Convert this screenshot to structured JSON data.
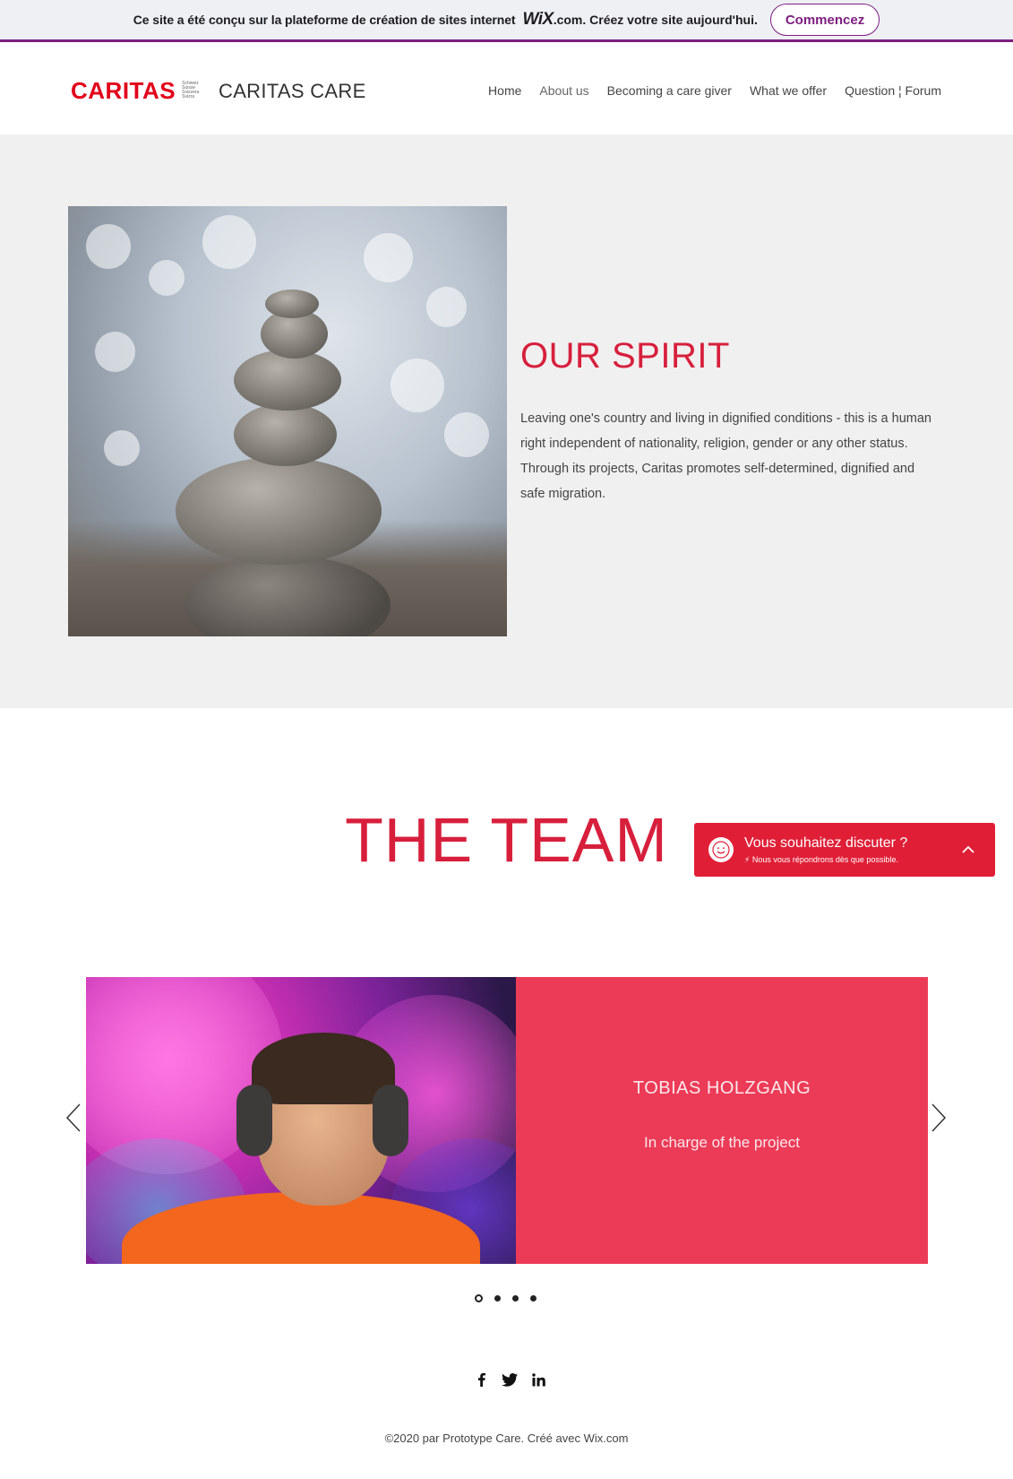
{
  "wix_banner": {
    "text_before": "Ce site a été conçu sur la plateforme de création de sites internet",
    "logo": "WiX",
    "text_after": ".com. Créez votre site aujourd'hui.",
    "button_label": "Commencez"
  },
  "header": {
    "logo_word": "CARITAS",
    "logo_sub": [
      "Schweiz",
      "Suisse",
      "Svizzera",
      "Svizra"
    ],
    "site_title": "CARITAS CARE",
    "nav": [
      "Home",
      "About us",
      "Becoming a care giver",
      "What we offer",
      "Question ¦ Forum"
    ]
  },
  "spirit": {
    "title": "OUR SPIRIT",
    "text": "Leaving one's country and living in dignified conditions - this is a human right independent of nationality, religion, gender or any other status. Through its projects, Caritas promotes self-determined, dignified and safe migration."
  },
  "team": {
    "title": "THE TEAM",
    "member": {
      "name": "TOBIAS HOLZGANG",
      "role": "In charge of the project"
    },
    "slides_count": 4,
    "active_slide": 1
  },
  "chat": {
    "title": "Vous souhaitez discuter ?",
    "subtitle": "Nous vous répondrons dès que possible."
  },
  "social": [
    "facebook-icon",
    "twitter-icon",
    "linkedin-icon"
  ],
  "footer": {
    "text": "©2020 par Prototype Care. Créé avec Wix.com"
  },
  "colors": {
    "accent_red": "#d71f3c",
    "wix_purple": "#7d1e81",
    "panel_red": "#ec3b57",
    "chat_red": "#e01f37"
  }
}
